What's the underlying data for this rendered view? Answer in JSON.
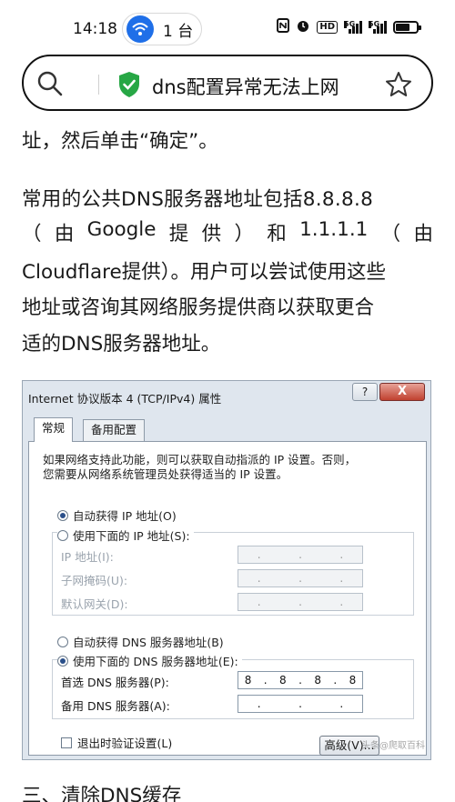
{
  "status_bar": {
    "time": "14:18",
    "hotspot_count": "1 台",
    "net_label_1": "5G",
    "net_label_2": "5G",
    "battery_level": 0.7
  },
  "search": {
    "query": "dns配置异常无法上网"
  },
  "article": {
    "line_top_cut": "址，然后单击“确定”。",
    "p_line1": "常用的公共DNS服务器地址包括8.8.8.8",
    "p_line2_tokens": [
      "（",
      "由",
      "Google",
      "提",
      "供",
      "）",
      "和",
      "1.1.1.1",
      "（",
      "由"
    ],
    "p_line3": "Cloudflare提供）。用户可以尝试使用这些",
    "p_line4": "地址或咨询其网络服务提供商以获取更合",
    "p_line5": "适的DNS服务器地址。",
    "next_heading": "三、清除DNS缓存"
  },
  "dialog": {
    "title": "Internet 协议版本 4 (TCP/IPv4) 属性",
    "help_label": "?",
    "close_label": "X",
    "tabs": [
      "常规",
      "备用配置"
    ],
    "description_line1": "如果网络支持此功能，则可以获取自动指派的 IP 设置。否则，",
    "description_line2": "您需要从网络系统管理员处获得适当的 IP 设置。",
    "radio_auto_ip": "自动获得 IP 地址(O)",
    "radio_manual_ip": "使用下面的 IP 地址(S):",
    "label_ip": "IP 地址(I):",
    "label_mask": "子网掩码(U):",
    "label_gateway": "默认网关(D):",
    "radio_auto_dns": "自动获得 DNS 服务器地址(B)",
    "radio_manual_dns": "使用下面的 DNS 服务器地址(E):",
    "label_pref_dns": "首选 DNS 服务器(P):",
    "label_alt_dns": "备用 DNS 服务器(A):",
    "pref_dns_octets": [
      "8",
      "8",
      "8",
      "8"
    ],
    "checkbox_validate": "退出时验证设置(L)",
    "advanced_button": "高级(V)...",
    "watermark": "头条@爬取百科"
  }
}
